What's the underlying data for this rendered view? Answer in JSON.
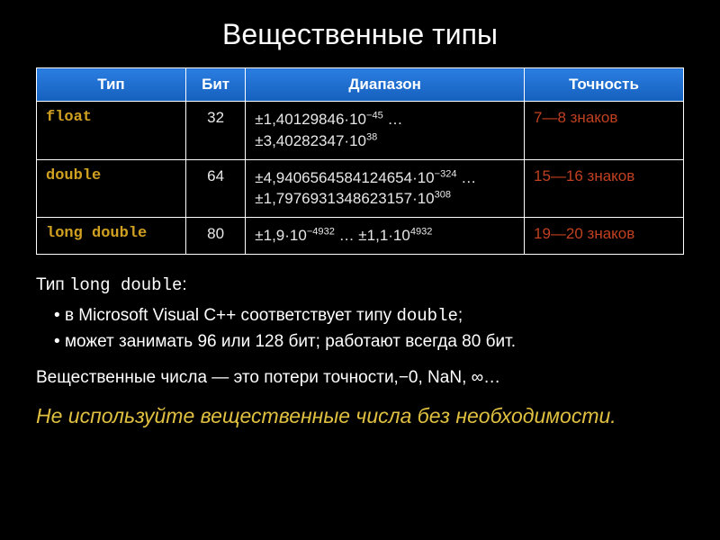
{
  "title": "Вещественные типы",
  "headers": {
    "type": "Тип",
    "bits": "Бит",
    "range": "Диапазон",
    "precision": "Точность"
  },
  "rows": [
    {
      "type": "float",
      "bits": "32",
      "range_html": "±1,40129846·10<sup>−45</sup> …<br>±3,40282347·10<sup>38</sup>",
      "precision": "7—8 знаков"
    },
    {
      "type": "double",
      "bits": "64",
      "range_html": "±4,9406564584124654·10<sup>−324</sup> …<br>±1,7976931348623157·10<sup>308</sup>",
      "precision": "15—16 знаков"
    },
    {
      "type": "long double",
      "bits": "80",
      "range_html": "±1,9·10<sup>−4932</sup> … ±1,1·10<sup>4932</sup>",
      "precision": "19—20 знаков"
    }
  ],
  "body": {
    "intro_prefix": "Тип ",
    "intro_mono": "long double",
    "intro_suffix": ":",
    "bullets": [
      {
        "pre": "в Microsoft Visual C++ соответствует типу ",
        "mono": "double",
        "post": ";"
      },
      {
        "pre": "может занимать 96 или 128 бит; работают всегда 80 бит.",
        "mono": "",
        "post": ""
      }
    ],
    "sentence": "Вещественные числа — это потери точности,−0, NaN, ∞…",
    "callout": "Не используйте вещественные числа без необходимости."
  }
}
